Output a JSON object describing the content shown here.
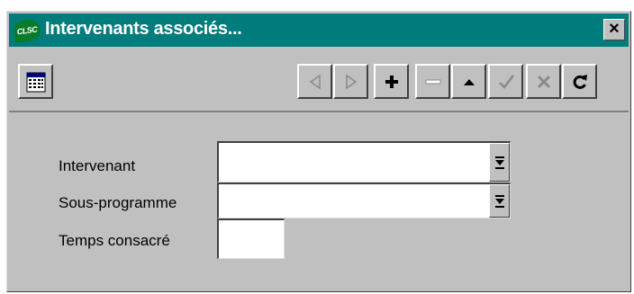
{
  "window": {
    "title": "Intervenants associés...",
    "logo_text": "CLSC",
    "close_label": "×"
  },
  "toolbar": {
    "buttons": [
      {
        "name": "calendar",
        "icon": "calendar-icon",
        "enabled": true
      },
      {
        "name": "previous",
        "icon": "triangle-left-icon",
        "enabled": false
      },
      {
        "name": "next",
        "icon": "triangle-right-icon",
        "enabled": false
      },
      {
        "name": "add",
        "icon": "plus-icon",
        "enabled": true
      },
      {
        "name": "delete",
        "icon": "minus-icon",
        "enabled": false
      },
      {
        "name": "up",
        "icon": "triangle-up-icon",
        "enabled": true
      },
      {
        "name": "confirm",
        "icon": "check-icon",
        "enabled": false
      },
      {
        "name": "cancel",
        "icon": "x-icon",
        "enabled": false
      },
      {
        "name": "refresh",
        "icon": "refresh-icon",
        "enabled": true
      }
    ]
  },
  "form": {
    "intervenant": {
      "label": "Intervenant",
      "value": ""
    },
    "sous_programme": {
      "label": "Sous-programme",
      "value": ""
    },
    "temps_consacre": {
      "label": "Temps consacré",
      "value": ""
    }
  },
  "colors": {
    "titlebar": "#007c7c",
    "face": "#c0c0c0",
    "disabled_icon": "#8a8a8a"
  }
}
